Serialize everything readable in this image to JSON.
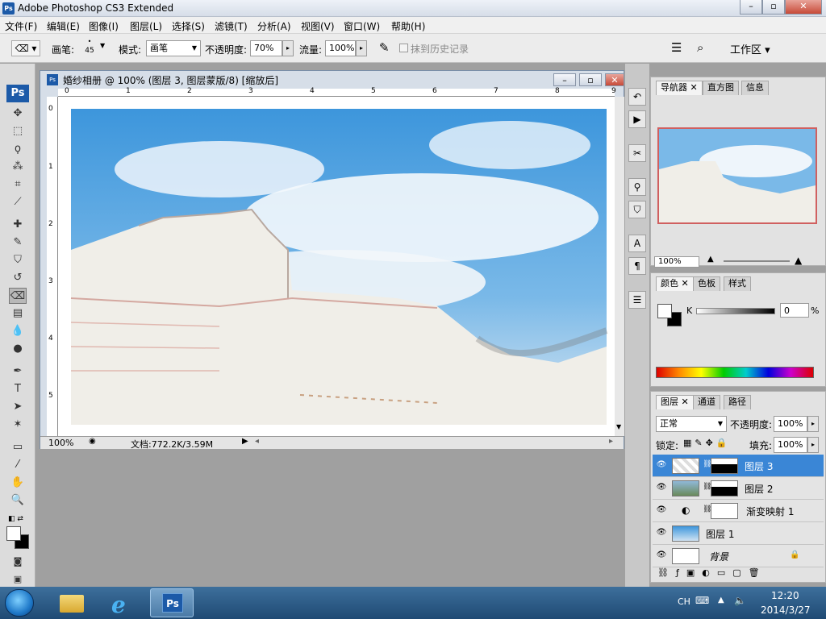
{
  "window": {
    "title": "Adobe Photoshop CS3 Extended",
    "icon": "Ps"
  },
  "menu": [
    "文件(F)",
    "编辑(E)",
    "图像(I)",
    "图层(L)",
    "选择(S)",
    "滤镜(T)",
    "分析(A)",
    "视图(V)",
    "窗口(W)",
    "帮助(H)"
  ],
  "options": {
    "brush_label": "画笔:",
    "brush_size": "45",
    "mode_label": "模式:",
    "mode_value": "画笔",
    "opacity_label": "不透明度:",
    "opacity_value": "70%",
    "flow_label": "流量:",
    "flow_value": "100%",
    "history_label": "抹到历史记录",
    "workspace_label": "工作区"
  },
  "document": {
    "title": "婚纱相册 @ 100% (图层 3, 图层蒙版/8) [缩放后]",
    "zoom": "100%",
    "doc_info": "文档:772.2K/3.59M",
    "ruler_top": [
      "0",
      "1",
      "2",
      "3",
      "4",
      "5",
      "6",
      "7",
      "8",
      "9"
    ],
    "ruler_left": [
      "0",
      "1",
      "2",
      "3",
      "4",
      "5"
    ]
  },
  "navigator": {
    "tabs": [
      "导航器",
      "直方图",
      "信息"
    ],
    "zoom": "100%"
  },
  "color_panel": {
    "tabs": [
      "颜色",
      "色板",
      "样式"
    ],
    "channel": "K",
    "value": "0",
    "unit": "%"
  },
  "layers_panel": {
    "tabs": [
      "图层",
      "通道",
      "路径"
    ],
    "blend_mode": "正常",
    "opacity_label": "不透明度:",
    "opacity_value": "100%",
    "lock_label": "锁定:",
    "fill_label": "填充:",
    "fill_value": "100%",
    "layers": [
      {
        "name": "图层 3",
        "selected": true
      },
      {
        "name": "图层 2",
        "selected": false
      },
      {
        "name": "渐变映射 1",
        "selected": false
      },
      {
        "name": "图层 1",
        "selected": false
      },
      {
        "name": "背景",
        "selected": false
      }
    ]
  },
  "taskbar": {
    "lang": "CH",
    "time": "12:20",
    "date": "2014/3/27"
  },
  "colors": {
    "accent": "#3a86d6",
    "sky": "#4fa3e0"
  }
}
